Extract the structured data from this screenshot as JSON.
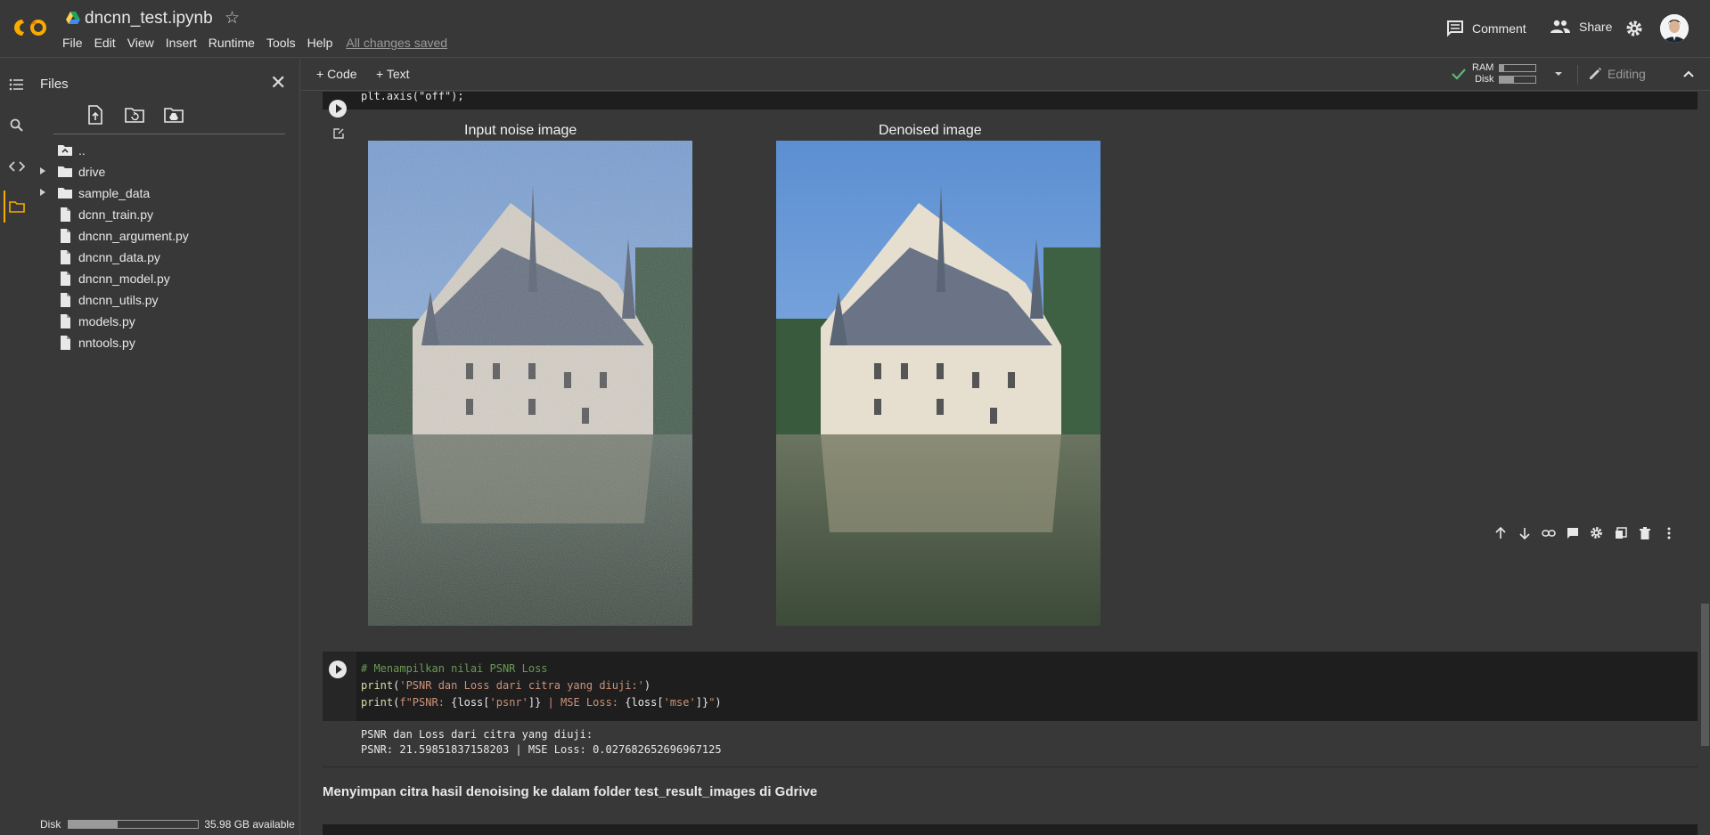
{
  "header": {
    "notebook_title": "dncnn_test.ipynb",
    "menu": [
      "File",
      "Edit",
      "View",
      "Insert",
      "Runtime",
      "Tools",
      "Help"
    ],
    "save_status": "All changes saved",
    "comment_label": "Comment",
    "share_label": "Share"
  },
  "files_panel": {
    "title": "Files",
    "items": [
      {
        "label": "..",
        "type": "parent"
      },
      {
        "label": "drive",
        "type": "folder"
      },
      {
        "label": "sample_data",
        "type": "folder"
      },
      {
        "label": "dcnn_train.py",
        "type": "file"
      },
      {
        "label": "dncnn_argument.py",
        "type": "file"
      },
      {
        "label": "dncnn_data.py",
        "type": "file"
      },
      {
        "label": "dncnn_model.py",
        "type": "file"
      },
      {
        "label": "dncnn_utils.py",
        "type": "file"
      },
      {
        "label": "models.py",
        "type": "file"
      },
      {
        "label": "nntools.py",
        "type": "file"
      }
    ],
    "disk_label": "Disk",
    "disk_available": "35.98 GB available",
    "disk_used_fraction": 0.38
  },
  "toolbar": {
    "add_code": "+ Code",
    "add_text": "+ Text",
    "ram_label": "RAM",
    "disk_label": "Disk",
    "ram_fraction": 0.12,
    "disk_fraction": 0.4,
    "mode_label": "Editing"
  },
  "cells": {
    "prev_code_line": "plt.axis(\"off\");",
    "figure_title_left": "Input noise image",
    "figure_title_right": "Denoised image",
    "code_comment": "# Menampilkan nilai PSNR Loss",
    "code_line1_fn": "print",
    "code_line1_str": "'PSNR dan Loss dari citra yang diuji:'",
    "code_line2_fn": "print",
    "code_line2_a": "f\"PSNR: ",
    "code_line2_b": "{loss[",
    "code_line2_c": "'psnr'",
    "code_line2_d": "]}",
    "code_line2_e": " | MSE Loss: ",
    "code_line2_f": "{loss[",
    "code_line2_g": "'mse'",
    "code_line2_h": "]}",
    "code_line2_i": "\"",
    "output_line1": "PSNR dan Loss dari citra yang diuji:",
    "output_line2": "PSNR: 21.59851837158203 | MSE Loss: 0.027682652696967125",
    "text_cell": "Menyimpan citra hasil denoising ke dalam folder test_result_images di Gdrive"
  },
  "colors": {
    "comment": "#6a9955",
    "string": "#ce9178",
    "keyword": "#dcdcaa",
    "orange_accent": "#f9ab00"
  }
}
